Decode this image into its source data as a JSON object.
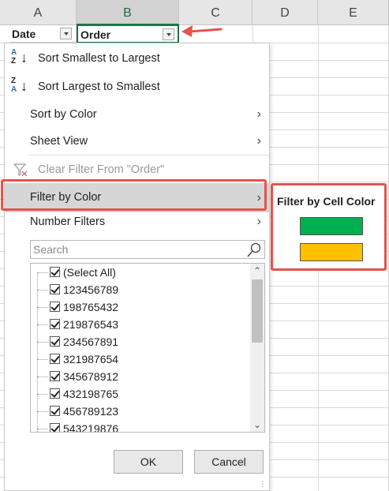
{
  "columns": [
    "A",
    "B",
    "C",
    "D",
    "E"
  ],
  "header_cells": {
    "date": "Date",
    "order": "Order"
  },
  "menu": {
    "sort_asc": "Sort Smallest to Largest",
    "sort_desc": "Sort Largest to Smallest",
    "sort_asc_icon": {
      "top": "A",
      "bottom": "Z",
      "arrow": "↓"
    },
    "sort_desc_icon": {
      "top": "Z",
      "bottom": "A",
      "arrow": "↓"
    },
    "sort_by_color": "Sort by Color",
    "sheet_view": "Sheet View",
    "clear_filter": "Clear Filter From \"Order\"",
    "filter_by_color": "Filter by Color",
    "number_filters": "Number Filters",
    "chevron": "›"
  },
  "search": {
    "placeholder": "Search"
  },
  "filter_list": [
    "(Select All)",
    "123456789",
    "198765432",
    "219876543",
    "234567891",
    "321987654",
    "345678912",
    "432198765",
    "456789123",
    "543219876"
  ],
  "buttons": {
    "ok": "OK",
    "cancel": "Cancel"
  },
  "color_panel": {
    "title": "Filter by Cell Color",
    "colors": [
      "#00b050",
      "#ffc000"
    ]
  },
  "accent": {
    "highlight": "#e5534b",
    "excel_green": "#217346"
  }
}
